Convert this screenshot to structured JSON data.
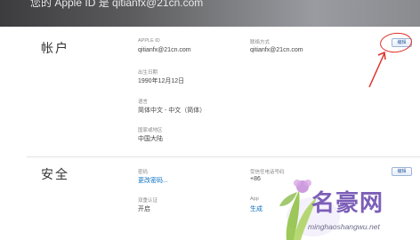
{
  "banner": {
    "text": "您的 Apple ID 是 qitianfx@21cn.com"
  },
  "account": {
    "title": "帐户",
    "apple_id_label": "APPLE ID",
    "apple_id_value": "qitianfx@21cn.com",
    "birthday_label": "出生日期",
    "birthday_value": "1990年12月12日",
    "language_label": "语言",
    "language_value": "简体中文 - 中文（简体）",
    "region_label": "国家或地区",
    "region_value": "中国大陆",
    "contact_label": "联络方式",
    "contact_value": "qitianfx@21cn.com",
    "edit_label": "编辑"
  },
  "security": {
    "title": "安全",
    "password_label": "密码",
    "change_password_link": "更改密码...",
    "two_step_label": "双重认证",
    "two_step_value": "开启",
    "trusted_phone_label": "受信任电话号码",
    "trusted_phone_value": "+86",
    "app_passwords_label": "App",
    "app_passwords_link": "生成",
    "edit_label": "编辑"
  },
  "watermark": {
    "text": "名豪网",
    "url": "minghaoshangwu.net"
  },
  "colors": {
    "link": "#0a6fc2",
    "annotation": "#e0322b",
    "watermark": "#7c5fb8"
  }
}
